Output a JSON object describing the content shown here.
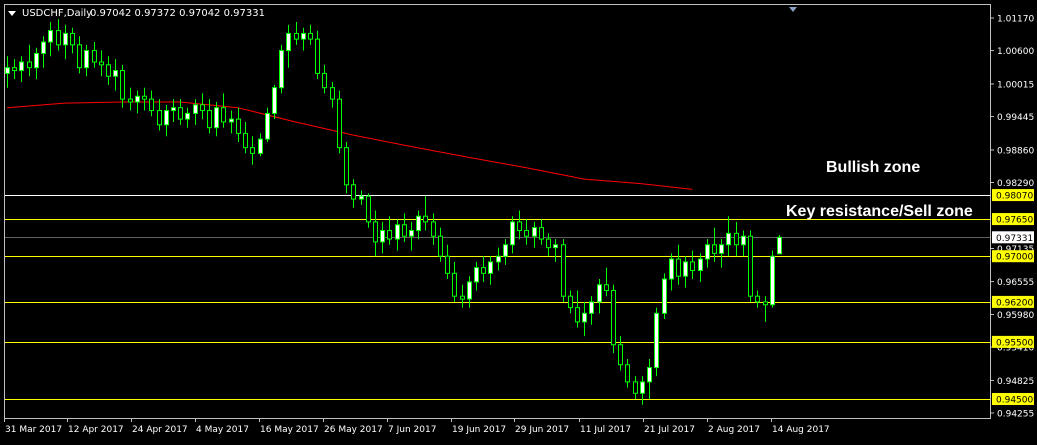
{
  "header": {
    "symbol": "USDCHF,Daily",
    "values": "0.97042 0.97372 0.97042 0.97331"
  },
  "colors": {
    "background": "#000000",
    "frame": "#c0c0c0",
    "text": "#ffffff",
    "bull_body": "#ffffff",
    "bear_body": "#000000",
    "wick": "#00ff00",
    "ma_line": "#ff0000",
    "level_line": "#ffff00",
    "level_label_bg": "#ffff00",
    "price_label_bg": "#ffffff",
    "resistance_line": "#ffffff"
  },
  "chart_data": {
    "type": "candlestick",
    "title": "USDCHF,Daily",
    "ylim": [
      0.94255,
      1.0117
    ],
    "price_axis_ticks": [
      "1.01170",
      "1.00600",
      "1.00015",
      "0.99445",
      "0.98860",
      "0.98290",
      "0.97135",
      "0.96555",
      "0.95980",
      "0.95410",
      "0.94825",
      "0.94255"
    ],
    "date_labels": [
      "31 Mar 2017",
      "12 Apr 2017",
      "24 Apr 2017",
      "4 May 2017",
      "16 May 2017",
      "26 May 2017",
      "7 Jun 2017",
      "19 Jun 2017",
      "29 Jun 2017",
      "11 Jul 2017",
      "21 Jul 2017",
      "2 Aug 2017",
      "14 Aug 2017"
    ],
    "current_price": "0.97331",
    "horizontal_levels": [
      {
        "label": "0.98070",
        "value": 0.9807,
        "style": "white"
      },
      {
        "label": "0.97650",
        "value": 0.9765,
        "style": "yellow"
      },
      {
        "label": "0.97000",
        "value": 0.97,
        "style": "yellow"
      },
      {
        "label": "0.96200",
        "value": 0.962,
        "style": "yellow"
      },
      {
        "label": "0.95500",
        "value": 0.955,
        "style": "yellow"
      },
      {
        "label": "0.94500",
        "value": 0.945,
        "style": "yellow"
      }
    ],
    "annotations": [
      "Bullish zone",
      "Key resistance/Sell zone"
    ],
    "moving_average": [
      {
        "date": "2017-03-31",
        "value": 0.996
      },
      {
        "date": "2017-04-12",
        "value": 0.9968
      },
      {
        "date": "2017-04-24",
        "value": 0.997
      },
      {
        "date": "2017-05-04",
        "value": 0.997
      },
      {
        "date": "2017-05-16",
        "value": 0.996
      },
      {
        "date": "2017-05-26",
        "value": 0.9935
      },
      {
        "date": "2017-06-07",
        "value": 0.9912
      },
      {
        "date": "2017-06-19",
        "value": 0.9892
      },
      {
        "date": "2017-06-29",
        "value": 0.9873
      },
      {
        "date": "2017-07-11",
        "value": 0.9855
      },
      {
        "date": "2017-07-21",
        "value": 0.9835
      },
      {
        "date": "2017-08-02",
        "value": 0.9827
      },
      {
        "date": "2017-08-11",
        "value": 0.9817
      }
    ],
    "ohlc": [
      {
        "date": "2017-03-31",
        "o": 1.002,
        "h": 1.005,
        "l": 0.9995,
        "c": 1.003
      },
      {
        "date": "2017-04-03",
        "o": 1.003,
        "h": 1.0045,
        "l": 1.001,
        "c": 1.0025
      },
      {
        "date": "2017-04-04",
        "o": 1.0025,
        "h": 1.005,
        "l": 1.0005,
        "c": 1.004
      },
      {
        "date": "2017-04-05",
        "o": 1.004,
        "h": 1.007,
        "l": 1.0015,
        "c": 1.003
      },
      {
        "date": "2017-04-06",
        "o": 1.003,
        "h": 1.0065,
        "l": 1.001,
        "c": 1.0055
      },
      {
        "date": "2017-04-07",
        "o": 1.0055,
        "h": 1.0085,
        "l": 1.003,
        "c": 1.0075
      },
      {
        "date": "2017-04-10",
        "o": 1.0075,
        "h": 1.011,
        "l": 1.005,
        "c": 1.0095
      },
      {
        "date": "2017-04-11",
        "o": 1.0095,
        "h": 1.0115,
        "l": 1.006,
        "c": 1.007
      },
      {
        "date": "2017-04-12",
        "o": 1.007,
        "h": 1.0105,
        "l": 1.0045,
        "c": 1.009
      },
      {
        "date": "2017-04-13",
        "o": 1.009,
        "h": 1.01,
        "l": 1.0055,
        "c": 1.007
      },
      {
        "date": "2017-04-14",
        "o": 1.007,
        "h": 1.0085,
        "l": 1.002,
        "c": 1.003
      },
      {
        "date": "2017-04-17",
        "o": 1.003,
        "h": 1.007,
        "l": 1.0015,
        "c": 1.006
      },
      {
        "date": "2017-04-18",
        "o": 1.006,
        "h": 1.0075,
        "l": 1.003,
        "c": 1.004
      },
      {
        "date": "2017-04-19",
        "o": 1.004,
        "h": 1.006,
        "l": 1.0015,
        "c": 1.0035
      },
      {
        "date": "2017-04-20",
        "o": 1.0035,
        "h": 1.005,
        "l": 1.0,
        "c": 1.0015
      },
      {
        "date": "2017-04-21",
        "o": 1.0015,
        "h": 1.0045,
        "l": 0.999,
        "c": 1.0025
      },
      {
        "date": "2017-04-24",
        "o": 1.0025,
        "h": 1.0035,
        "l": 0.996,
        "c": 0.9975
      },
      {
        "date": "2017-04-25",
        "o": 0.9975,
        "h": 0.9995,
        "l": 0.9955,
        "c": 0.997
      },
      {
        "date": "2017-04-26",
        "o": 0.997,
        "h": 0.999,
        "l": 0.995,
        "c": 0.998
      },
      {
        "date": "2017-04-27",
        "o": 0.998,
        "h": 0.9995,
        "l": 0.9955,
        "c": 0.9975
      },
      {
        "date": "2017-04-28",
        "o": 0.9975,
        "h": 0.999,
        "l": 0.9945,
        "c": 0.9955
      },
      {
        "date": "2017-05-01",
        "o": 0.9955,
        "h": 0.9975,
        "l": 0.992,
        "c": 0.993
      },
      {
        "date": "2017-05-02",
        "o": 0.993,
        "h": 0.9965,
        "l": 0.991,
        "c": 0.9955
      },
      {
        "date": "2017-05-03",
        "o": 0.9955,
        "h": 0.9975,
        "l": 0.9935,
        "c": 0.996
      },
      {
        "date": "2017-05-04",
        "o": 0.996,
        "h": 0.9975,
        "l": 0.993,
        "c": 0.994
      },
      {
        "date": "2017-05-05",
        "o": 0.994,
        "h": 0.996,
        "l": 0.9925,
        "c": 0.995
      },
      {
        "date": "2017-05-08",
        "o": 0.995,
        "h": 0.9975,
        "l": 0.993,
        "c": 0.9965
      },
      {
        "date": "2017-05-09",
        "o": 0.9965,
        "h": 0.9985,
        "l": 0.994,
        "c": 0.9955
      },
      {
        "date": "2017-05-10",
        "o": 0.9955,
        "h": 0.9975,
        "l": 0.9915,
        "c": 0.9925
      },
      {
        "date": "2017-05-11",
        "o": 0.9925,
        "h": 0.997,
        "l": 0.991,
        "c": 0.996
      },
      {
        "date": "2017-05-12",
        "o": 0.996,
        "h": 0.9985,
        "l": 0.9925,
        "c": 0.9935
      },
      {
        "date": "2017-05-15",
        "o": 0.9935,
        "h": 0.9955,
        "l": 0.9915,
        "c": 0.994
      },
      {
        "date": "2017-05-16",
        "o": 0.994,
        "h": 0.996,
        "l": 0.99,
        "c": 0.9915
      },
      {
        "date": "2017-05-17",
        "o": 0.9915,
        "h": 0.9935,
        "l": 0.988,
        "c": 0.989
      },
      {
        "date": "2017-05-18",
        "o": 0.989,
        "h": 0.991,
        "l": 0.986,
        "c": 0.988
      },
      {
        "date": "2017-05-19",
        "o": 0.988,
        "h": 0.9915,
        "l": 0.9875,
        "c": 0.9905
      },
      {
        "date": "2017-05-22",
        "o": 0.9905,
        "h": 0.996,
        "l": 0.99,
        "c": 0.995
      },
      {
        "date": "2017-05-23",
        "o": 0.995,
        "h": 1.0,
        "l": 0.994,
        "c": 0.9995
      },
      {
        "date": "2017-05-24",
        "o": 0.9995,
        "h": 1.007,
        "l": 0.9985,
        "c": 1.006
      },
      {
        "date": "2017-05-25",
        "o": 1.006,
        "h": 1.0105,
        "l": 1.003,
        "c": 1.009
      },
      {
        "date": "2017-05-26",
        "o": 1.009,
        "h": 1.011,
        "l": 1.007,
        "c": 1.008
      },
      {
        "date": "2017-05-29",
        "o": 1.008,
        "h": 1.01,
        "l": 1.006,
        "c": 1.009
      },
      {
        "date": "2017-05-30",
        "o": 1.009,
        "h": 1.0105,
        "l": 1.007,
        "c": 1.008
      },
      {
        "date": "2017-05-31",
        "o": 1.008,
        "h": 1.0095,
        "l": 1.001,
        "c": 1.002
      },
      {
        "date": "2017-06-01",
        "o": 1.002,
        "h": 1.0035,
        "l": 0.9985,
        "c": 0.9995
      },
      {
        "date": "2017-06-02",
        "o": 0.9995,
        "h": 1.0005,
        "l": 0.996,
        "c": 0.9975
      },
      {
        "date": "2017-06-05",
        "o": 0.9975,
        "h": 0.999,
        "l": 0.988,
        "c": 0.989
      },
      {
        "date": "2017-06-06",
        "o": 0.989,
        "h": 0.99,
        "l": 0.981,
        "c": 0.9825
      },
      {
        "date": "2017-06-07",
        "o": 0.9825,
        "h": 0.9835,
        "l": 0.9785,
        "c": 0.98
      },
      {
        "date": "2017-06-08",
        "o": 0.98,
        "h": 0.9815,
        "l": 0.979,
        "c": 0.9805
      },
      {
        "date": "2017-06-09",
        "o": 0.9805,
        "h": 0.981,
        "l": 0.975,
        "c": 0.976
      },
      {
        "date": "2017-06-12",
        "o": 0.976,
        "h": 0.978,
        "l": 0.97,
        "c": 0.9725
      },
      {
        "date": "2017-06-13",
        "o": 0.9725,
        "h": 0.976,
        "l": 0.9705,
        "c": 0.9745
      },
      {
        "date": "2017-06-14",
        "o": 0.9745,
        "h": 0.977,
        "l": 0.972,
        "c": 0.973
      },
      {
        "date": "2017-06-15",
        "o": 0.973,
        "h": 0.9765,
        "l": 0.971,
        "c": 0.9755
      },
      {
        "date": "2017-06-16",
        "o": 0.9755,
        "h": 0.9775,
        "l": 0.9725,
        "c": 0.9735
      },
      {
        "date": "2017-06-19",
        "o": 0.9735,
        "h": 0.976,
        "l": 0.971,
        "c": 0.9745
      },
      {
        "date": "2017-06-20",
        "o": 0.9745,
        "h": 0.978,
        "l": 0.973,
        "c": 0.977
      },
      {
        "date": "2017-06-21",
        "o": 0.977,
        "h": 0.9805,
        "l": 0.9745,
        "c": 0.976
      },
      {
        "date": "2017-06-22",
        "o": 0.976,
        "h": 0.9775,
        "l": 0.972,
        "c": 0.9735
      },
      {
        "date": "2017-06-23",
        "o": 0.9735,
        "h": 0.975,
        "l": 0.969,
        "c": 0.97
      },
      {
        "date": "2017-06-26",
        "o": 0.97,
        "h": 0.972,
        "l": 0.966,
        "c": 0.967
      },
      {
        "date": "2017-06-27",
        "o": 0.967,
        "h": 0.969,
        "l": 0.962,
        "c": 0.963
      },
      {
        "date": "2017-06-28",
        "o": 0.963,
        "h": 0.965,
        "l": 0.961,
        "c": 0.9625
      },
      {
        "date": "2017-06-29",
        "o": 0.9625,
        "h": 0.9665,
        "l": 0.961,
        "c": 0.9655
      },
      {
        "date": "2017-06-30",
        "o": 0.9655,
        "h": 0.969,
        "l": 0.964,
        "c": 0.968
      },
      {
        "date": "2017-07-03",
        "o": 0.968,
        "h": 0.97,
        "l": 0.9655,
        "c": 0.967
      },
      {
        "date": "2017-07-04",
        "o": 0.967,
        "h": 0.97,
        "l": 0.965,
        "c": 0.969
      },
      {
        "date": "2017-07-05",
        "o": 0.969,
        "h": 0.9715,
        "l": 0.9675,
        "c": 0.97
      },
      {
        "date": "2017-07-06",
        "o": 0.97,
        "h": 0.973,
        "l": 0.9685,
        "c": 0.972
      },
      {
        "date": "2017-07-07",
        "o": 0.972,
        "h": 0.977,
        "l": 0.9705,
        "c": 0.976
      },
      {
        "date": "2017-07-10",
        "o": 0.976,
        "h": 0.978,
        "l": 0.973,
        "c": 0.9745
      },
      {
        "date": "2017-07-11",
        "o": 0.9745,
        "h": 0.9765,
        "l": 0.972,
        "c": 0.9735
      },
      {
        "date": "2017-07-12",
        "o": 0.9735,
        "h": 0.976,
        "l": 0.9715,
        "c": 0.975
      },
      {
        "date": "2017-07-13",
        "o": 0.975,
        "h": 0.9765,
        "l": 0.972,
        "c": 0.973
      },
      {
        "date": "2017-07-14",
        "o": 0.973,
        "h": 0.974,
        "l": 0.97,
        "c": 0.9715
      },
      {
        "date": "2017-07-17",
        "o": 0.9715,
        "h": 0.973,
        "l": 0.969,
        "c": 0.972
      },
      {
        "date": "2017-07-18",
        "o": 0.972,
        "h": 0.973,
        "l": 0.962,
        "c": 0.963
      },
      {
        "date": "2017-07-19",
        "o": 0.963,
        "h": 0.964,
        "l": 0.96,
        "c": 0.961
      },
      {
        "date": "2017-07-20",
        "o": 0.961,
        "h": 0.964,
        "l": 0.9575,
        "c": 0.9585
      },
      {
        "date": "2017-07-21",
        "o": 0.9585,
        "h": 0.962,
        "l": 0.956,
        "c": 0.96
      },
      {
        "date": "2017-07-24",
        "o": 0.96,
        "h": 0.963,
        "l": 0.958,
        "c": 0.962
      },
      {
        "date": "2017-07-25",
        "o": 0.962,
        "h": 0.966,
        "l": 0.96,
        "c": 0.965
      },
      {
        "date": "2017-07-26",
        "o": 0.965,
        "h": 0.968,
        "l": 0.963,
        "c": 0.964
      },
      {
        "date": "2017-07-27",
        "o": 0.964,
        "h": 0.965,
        "l": 0.953,
        "c": 0.9545
      },
      {
        "date": "2017-07-28",
        "o": 0.9545,
        "h": 0.956,
        "l": 0.95,
        "c": 0.951
      },
      {
        "date": "2017-07-31",
        "o": 0.951,
        "h": 0.952,
        "l": 0.947,
        "c": 0.948
      },
      {
        "date": "2017-08-01",
        "o": 0.948,
        "h": 0.949,
        "l": 0.945,
        "c": 0.946
      },
      {
        "date": "2017-08-02",
        "o": 0.946,
        "h": 0.949,
        "l": 0.944,
        "c": 0.948
      },
      {
        "date": "2017-08-03",
        "o": 0.948,
        "h": 0.952,
        "l": 0.945,
        "c": 0.9505
      },
      {
        "date": "2017-08-04",
        "o": 0.9505,
        "h": 0.961,
        "l": 0.949,
        "c": 0.96
      },
      {
        "date": "2017-08-07",
        "o": 0.96,
        "h": 0.967,
        "l": 0.959,
        "c": 0.966
      },
      {
        "date": "2017-08-08",
        "o": 0.966,
        "h": 0.9705,
        "l": 0.964,
        "c": 0.9695
      },
      {
        "date": "2017-08-09",
        "o": 0.9695,
        "h": 0.972,
        "l": 0.965,
        "c": 0.9665
      },
      {
        "date": "2017-08-10",
        "o": 0.9665,
        "h": 0.97,
        "l": 0.9645,
        "c": 0.969
      },
      {
        "date": "2017-08-11",
        "o": 0.969,
        "h": 0.971,
        "l": 0.966,
        "c": 0.9675
      },
      {
        "date": "2017-08-14",
        "o": 0.9675,
        "h": 0.9705,
        "l": 0.9655,
        "c": 0.9695
      },
      {
        "date": "2017-08-15",
        "o": 0.9695,
        "h": 0.973,
        "l": 0.968,
        "c": 0.972
      },
      {
        "date": "2017-08-16",
        "o": 0.972,
        "h": 0.975,
        "l": 0.969,
        "c": 0.9705
      },
      {
        "date": "2017-08-17",
        "o": 0.9705,
        "h": 0.973,
        "l": 0.968,
        "c": 0.972
      },
      {
        "date": "2017-08-18",
        "o": 0.972,
        "h": 0.977,
        "l": 0.97,
        "c": 0.974
      },
      {
        "date": "2017-08-21",
        "o": 0.974,
        "h": 0.976,
        "l": 0.97,
        "c": 0.972
      },
      {
        "date": "2017-08-22",
        "o": 0.972,
        "h": 0.9745,
        "l": 0.97,
        "c": 0.9735
      },
      {
        "date": "2017-08-23",
        "o": 0.9735,
        "h": 0.9745,
        "l": 0.962,
        "c": 0.963
      },
      {
        "date": "2017-08-24",
        "o": 0.963,
        "h": 0.964,
        "l": 0.961,
        "c": 0.962
      },
      {
        "date": "2017-08-25",
        "o": 0.962,
        "h": 0.963,
        "l": 0.9585,
        "c": 0.9615
      },
      {
        "date": "2017-08-28",
        "o": 0.9615,
        "h": 0.971,
        "l": 0.961,
        "c": 0.97
      },
      {
        "date": "2017-08-29",
        "o": 0.97042,
        "h": 0.97372,
        "l": 0.97042,
        "c": 0.97331
      }
    ]
  }
}
